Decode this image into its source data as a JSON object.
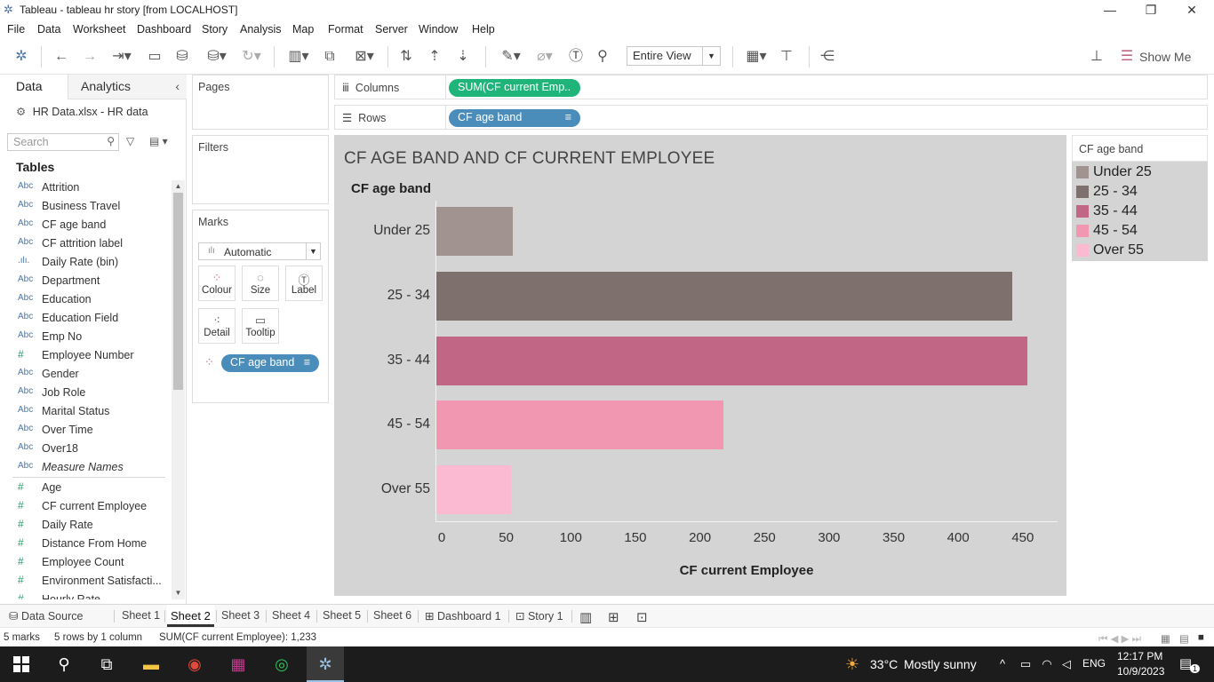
{
  "window": {
    "title": "Tableau - tableau hr story [from LOCALHOST]"
  },
  "menu": [
    "File",
    "Data",
    "Worksheet",
    "Dashboard",
    "Story",
    "Analysis",
    "Map",
    "Format",
    "Server",
    "Window",
    "Help"
  ],
  "toolbar": {
    "view_select": "Entire View",
    "show_me": "Show Me"
  },
  "left_panel": {
    "tab_data": "Data",
    "tab_analytics": "Analytics",
    "datasource": "HR Data.xlsx - HR data",
    "search_placeholder": "Search",
    "tables_heading": "Tables",
    "dimensions": [
      {
        "type": "Abc",
        "name": "Attrition"
      },
      {
        "type": "Abc",
        "name": "Business Travel"
      },
      {
        "type": "Abc",
        "name": "CF age band"
      },
      {
        "type": "Abc",
        "name": "CF attrition label"
      },
      {
        "type": ".ılı.",
        "name": "Daily Rate (bin)"
      },
      {
        "type": "Abc",
        "name": "Department"
      },
      {
        "type": "Abc",
        "name": "Education"
      },
      {
        "type": "Abc",
        "name": "Education Field"
      },
      {
        "type": "Abc",
        "name": "Emp No"
      },
      {
        "type": "#",
        "name": "Employee Number"
      },
      {
        "type": "Abc",
        "name": "Gender"
      },
      {
        "type": "Abc",
        "name": "Job Role"
      },
      {
        "type": "Abc",
        "name": "Marital Status"
      },
      {
        "type": "Abc",
        "name": "Over Time"
      },
      {
        "type": "Abc",
        "name": "Over18"
      },
      {
        "type": "Abc",
        "name": "Measure Names"
      }
    ],
    "measures": [
      {
        "type": "#",
        "name": "Age"
      },
      {
        "type": "#",
        "name": "CF current Employee"
      },
      {
        "type": "#",
        "name": "Daily Rate"
      },
      {
        "type": "#",
        "name": "Distance From Home"
      },
      {
        "type": "#",
        "name": "Employee Count"
      },
      {
        "type": "#",
        "name": "Environment Satisfacti..."
      },
      {
        "type": "#",
        "name": "Hourly Rate"
      }
    ]
  },
  "cards": {
    "pages": "Pages",
    "filters": "Filters",
    "marks": "Marks",
    "mark_type": "Automatic",
    "mark_buttons": [
      "Colour",
      "Size",
      "Label",
      "Detail",
      "Tooltip"
    ],
    "marks_pill": "CF age band"
  },
  "shelves": {
    "columns_label": "Columns",
    "columns_pill": "SUM(CF current Emp..",
    "rows_label": "Rows",
    "rows_pill": "CF age band"
  },
  "chart_data": {
    "type": "bar",
    "orientation": "horizontal",
    "title": "CF AGE BAND AND CF CURRENT EMPLOYEE",
    "ylabel": "CF age band",
    "xlabel": "CF current Employee",
    "categories": [
      "Under 25",
      "25 - 34",
      "35 - 44",
      "45 - 54",
      "Over 55"
    ],
    "values": [
      59,
      446,
      458,
      222,
      58
    ],
    "colors": [
      "#a09390",
      "#7e706d",
      "#c26686",
      "#f297b2",
      "#fbbad1"
    ],
    "xlim": [
      0,
      480
    ],
    "xticks": [
      0,
      50,
      100,
      150,
      200,
      250,
      300,
      350,
      400,
      450
    ],
    "grid": false,
    "legend_position": "right"
  },
  "legend": {
    "title": "CF age band"
  },
  "sheet_tabs": [
    "Data Source",
    "Sheet 1",
    "Sheet 2",
    "Sheet 3",
    "Sheet 4",
    "Sheet 5",
    "Sheet 6",
    "Dashboard 1",
    "Story 1"
  ],
  "active_sheet": "Sheet 2",
  "status": {
    "marks": "5 marks",
    "rows": "5 rows by 1 column",
    "sum": "SUM(CF current Employee): 1,233"
  },
  "taskbar": {
    "weather_temp": "33°C",
    "weather_desc": "Mostly sunny",
    "lang": "ENG",
    "time": "12:17 PM",
    "date": "10/9/2023",
    "notifications": "1"
  }
}
